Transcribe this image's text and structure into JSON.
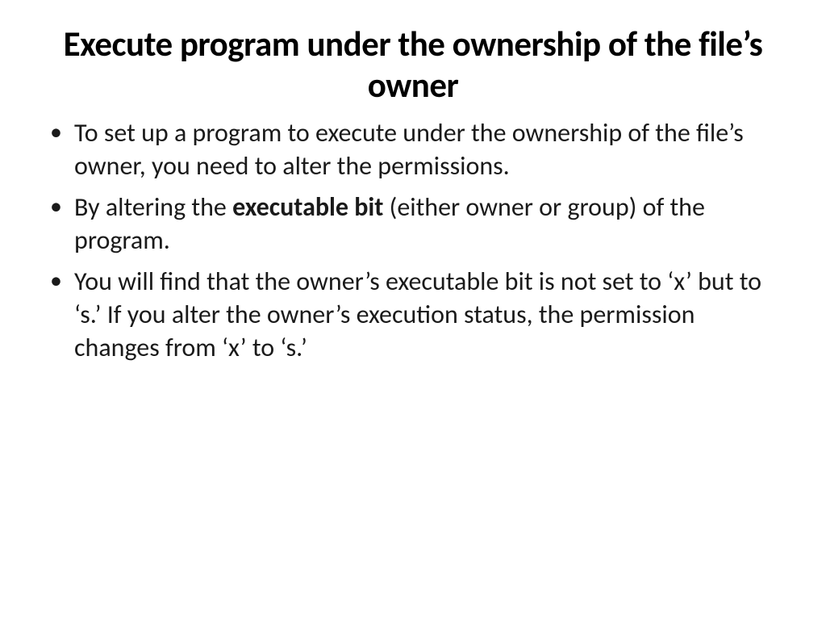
{
  "slide": {
    "title": "Execute program under the ownership of the file’s owner",
    "bullets": [
      {
        "pre": "To set up a program to execute under the ownership of the file’s owner, you need to alter the permissions.",
        "bold": "",
        "post": ""
      },
      {
        "pre": "By altering the ",
        "bold": "executable bit",
        "post": " (either owner or group) of the program."
      },
      {
        "pre": "You will find that the owner’s executable bit is not set to ‘x’ but to ‘s.’ If you alter the owner’s execution status, the permission changes from ‘x’ to ‘s.’",
        "bold": "",
        "post": ""
      }
    ]
  }
}
